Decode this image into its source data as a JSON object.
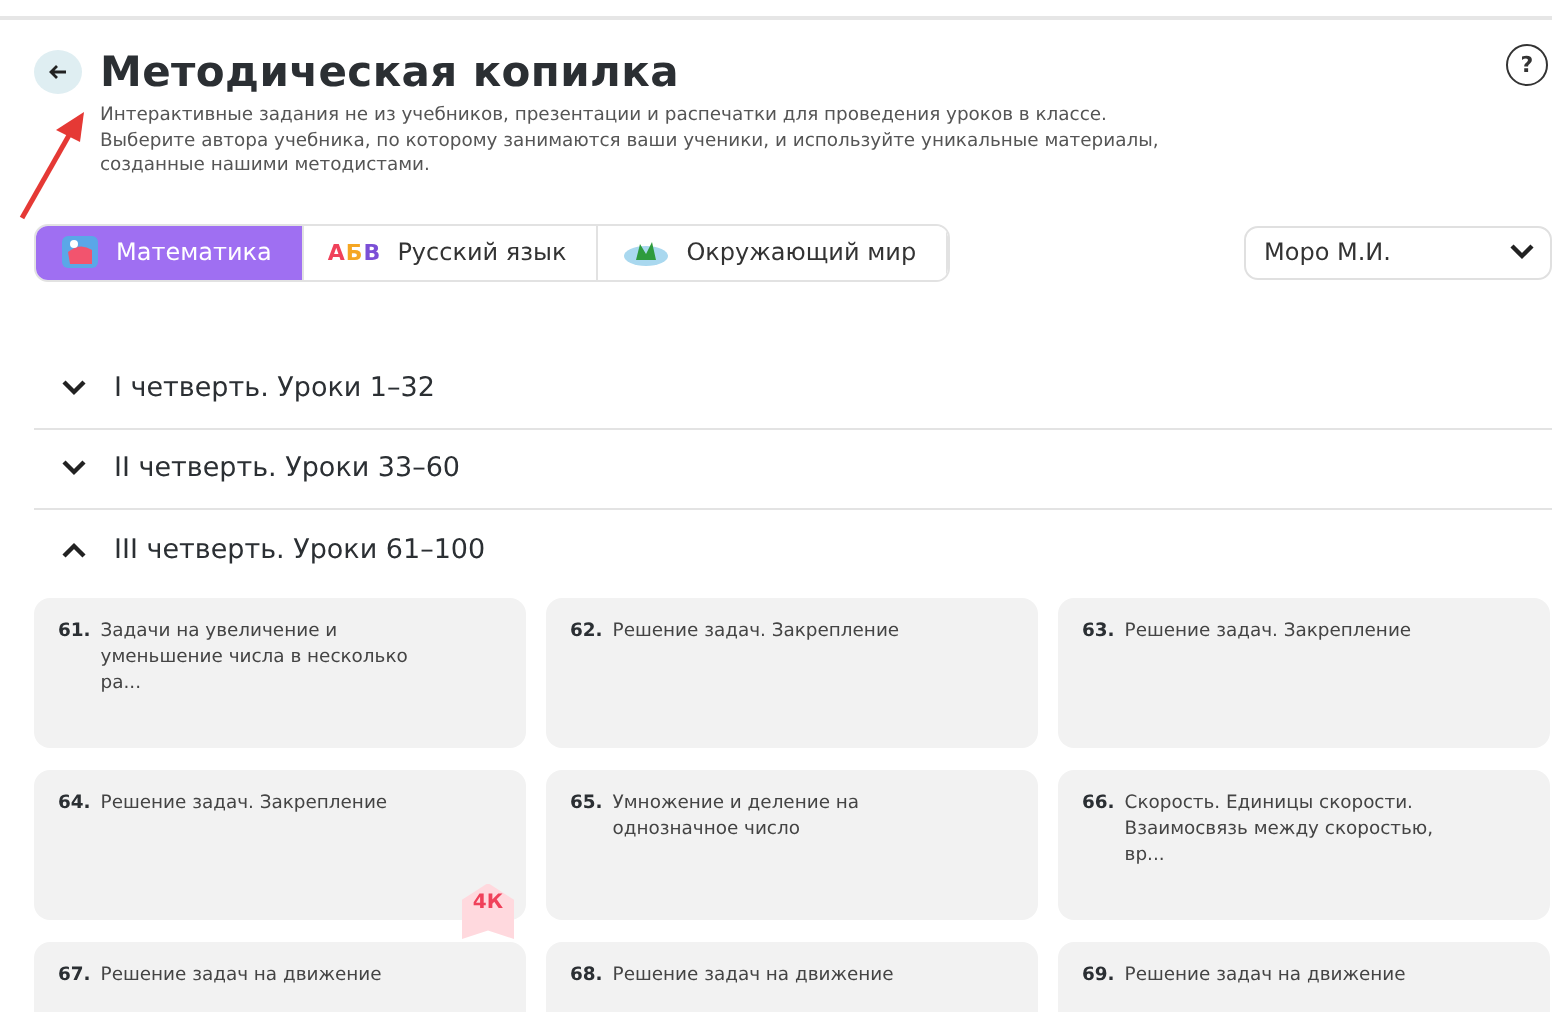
{
  "header": {
    "title": "Методическая копилка",
    "help": "?",
    "description": [
      "Интерактивные задания не из учебников, презентации и распечатки для проведения уроков в классе.",
      "Выберите автора учебника, по которому занимаются ваши ученики, и используйте уникальные материалы,",
      "созданные нашими методистами."
    ]
  },
  "tabs": [
    {
      "label": "Математика",
      "selected": true
    },
    {
      "label": "Русский язык",
      "icon_text": [
        "А",
        "Б",
        "В"
      ],
      "selected": false
    },
    {
      "label": "Окружающий мир",
      "selected": false
    }
  ],
  "author_select": {
    "value": "Моро М.И."
  },
  "sections": [
    {
      "title": "I четверть. Уроки 1–32",
      "expanded": false
    },
    {
      "title": "II четверть. Уроки 33–60",
      "expanded": false
    },
    {
      "title": "III четверть. Уроки 61–100",
      "expanded": true
    }
  ],
  "lessons": [
    {
      "number": "61.",
      "title": "Задачи на увеличение и уменьшение числа в несколько ра..."
    },
    {
      "number": "62.",
      "title": "Решение задач. Закрепление"
    },
    {
      "number": "63.",
      "title": "Решение задач. Закрепление"
    },
    {
      "number": "64.",
      "title": "Решение задач. Закрепление",
      "badge": "4К"
    },
    {
      "number": "65.",
      "title": "Умножение и деление на однозначное число"
    },
    {
      "number": "66.",
      "title": "Скорость. Единицы скорости. Взаимосвязь между скоростью, вр..."
    },
    {
      "number": "67.",
      "title": "Решение задач на движение"
    },
    {
      "number": "68.",
      "title": "Решение задач на движение"
    },
    {
      "number": "69.",
      "title": "Решение задач на движение"
    }
  ]
}
